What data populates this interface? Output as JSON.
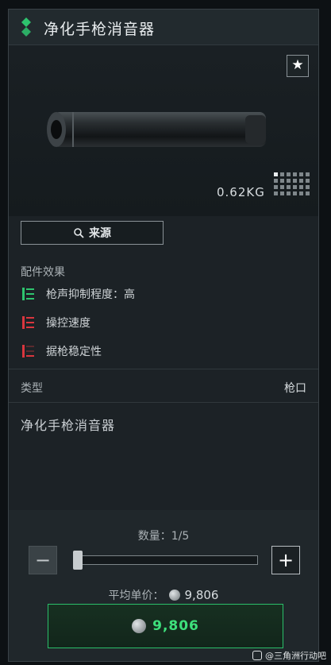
{
  "item": {
    "title": "净化手枪消音器",
    "weight": "0.62KG",
    "source_label": "来源",
    "type_label": "类型",
    "type_value": "枪口",
    "description": "净化手枪消音器"
  },
  "effects": {
    "section_label": "配件效果",
    "items": [
      {
        "label": "枪声抑制程度：高",
        "color": "#2ec46e"
      },
      {
        "label": "操控速度",
        "color": "#d9363e"
      },
      {
        "label": "据枪稳定性",
        "color": "#d9363e"
      }
    ]
  },
  "purchase": {
    "quantity_text": "数量：1/5",
    "quantity_fraction": 0.2,
    "avg_price_label": "平均单价：",
    "avg_price_value": "9,806",
    "buy_price": "9,806"
  },
  "icons": {
    "rarity": "rarity-diamond-icon",
    "favorite": "star-icon",
    "size_grid": "slot-grid-icon",
    "search": "search-icon",
    "coin": "coin-icon"
  },
  "colors": {
    "accent_green": "#2ec46e",
    "negative_red": "#d9363e",
    "panel_bg": "#1c2226"
  },
  "watermark": "@三角洲行动吧"
}
